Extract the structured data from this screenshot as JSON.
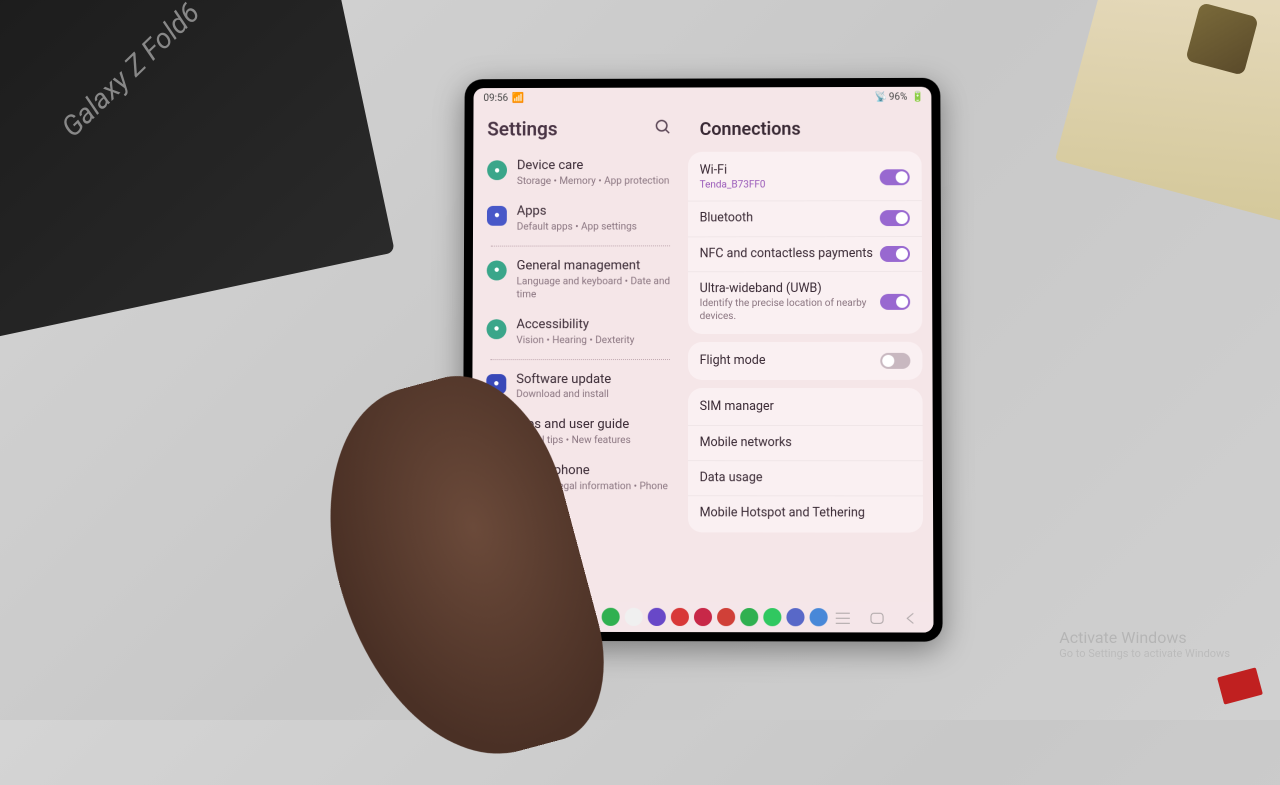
{
  "statusbar": {
    "time": "09:56",
    "battery": "96%"
  },
  "leftPane": {
    "title": "Settings"
  },
  "settingsItems": [
    {
      "title": "Device care",
      "subtitle": "Storage • Memory • App protection",
      "iconClass": "ico-teal"
    },
    {
      "title": "Apps",
      "subtitle": "Default apps • App settings",
      "iconClass": "ico-blue"
    },
    {
      "title": "General management",
      "subtitle": "Language and keyboard • Date and time",
      "iconClass": "ico-teal"
    },
    {
      "title": "Accessibility",
      "subtitle": "Vision • Hearing • Dexterity",
      "iconClass": "ico-teal"
    },
    {
      "title": "Software update",
      "subtitle": "Download and install",
      "iconClass": "ico-navy"
    },
    {
      "title": "Tips and user guide",
      "subtitle": "Useful tips • New features",
      "iconClass": "ico-orange"
    },
    {
      "title": "About phone",
      "subtitle": "Status • Legal information • Phone name",
      "iconClass": "ico-purple"
    }
  ],
  "rightPane": {
    "title": "Connections"
  },
  "connectionGroups": [
    [
      {
        "title": "Wi-Fi",
        "sub": "Tenda_B73FF0",
        "subAccent": true,
        "toggle": "on"
      },
      {
        "title": "Bluetooth",
        "sub": "",
        "toggle": "on"
      },
      {
        "title": "NFC and contactless payments",
        "sub": "",
        "toggle": "on"
      },
      {
        "title": "Ultra-wideband (UWB)",
        "sub": "Identify the precise location of nearby devices.",
        "toggle": "on"
      }
    ],
    [
      {
        "title": "Flight mode",
        "sub": "",
        "toggle": "off"
      }
    ],
    [
      {
        "title": "SIM manager",
        "sub": "",
        "toggle": null
      },
      {
        "title": "Mobile networks",
        "sub": "",
        "toggle": null
      },
      {
        "title": "Data usage",
        "sub": "",
        "toggle": null
      },
      {
        "title": "Mobile Hotspot and Tethering",
        "sub": "",
        "toggle": null
      }
    ]
  ],
  "dockColors": [
    "#30b050",
    "#f0f0f0",
    "#6848c8",
    "#d83838",
    "#c82848",
    "#d04038",
    "#30b050",
    "#30c860",
    "#5868c8",
    "#4888d8"
  ],
  "sceneText": "Galaxy Z Fold6",
  "watermark": {
    "main": "Activate Windows",
    "sub": "Go to Settings to activate Windows"
  }
}
